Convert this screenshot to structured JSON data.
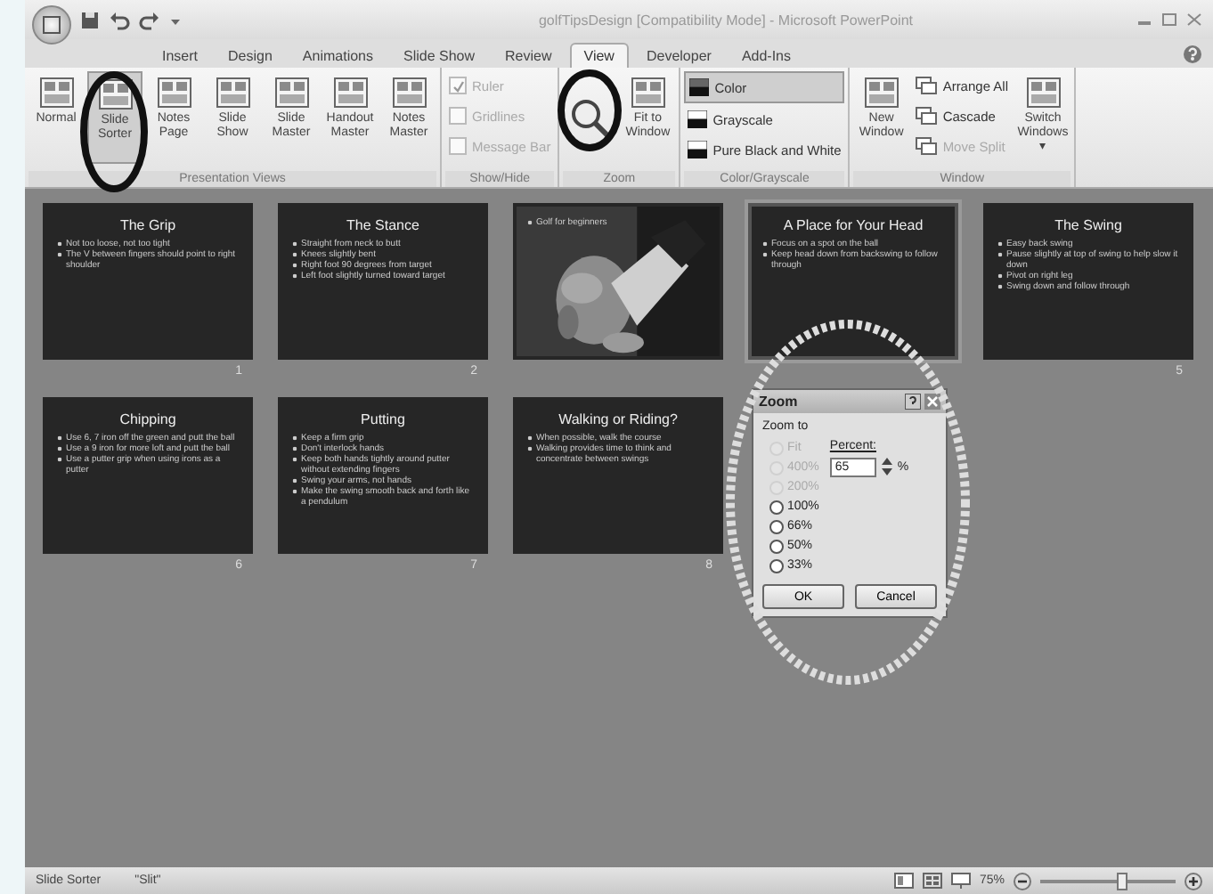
{
  "window": {
    "title": "golfTipsDesign [Compatibility Mode] - Microsoft PowerPoint"
  },
  "tabs": [
    {
      "label": "Insert",
      "selected": false
    },
    {
      "label": "Design",
      "selected": false
    },
    {
      "label": "Animations",
      "selected": false
    },
    {
      "label": "Slide Show",
      "selected": false
    },
    {
      "label": "Review",
      "selected": false
    },
    {
      "label": "View",
      "selected": true
    },
    {
      "label": "Developer",
      "selected": false
    },
    {
      "label": "Add-Ins",
      "selected": false
    }
  ],
  "ribbon": {
    "groups": [
      {
        "label": "Presentation Views",
        "items": [
          {
            "kind": "large",
            "label": "Normal"
          },
          {
            "kind": "large",
            "label": "Slide Sorter",
            "selected": true
          },
          {
            "kind": "large",
            "label": "Notes Page"
          },
          {
            "kind": "large",
            "label": "Slide Show"
          },
          {
            "kind": "large",
            "label": "Slide Master"
          },
          {
            "kind": "large",
            "label": "Handout Master"
          },
          {
            "kind": "large",
            "label": "Notes Master"
          }
        ]
      },
      {
        "label": "Show/Hide",
        "items": [
          {
            "kind": "check",
            "label": "Ruler",
            "checked": true,
            "disabled": true
          },
          {
            "kind": "check",
            "label": "Gridlines",
            "checked": false,
            "disabled": true
          },
          {
            "kind": "check",
            "label": "Message Bar",
            "checked": false,
            "disabled": true
          }
        ]
      },
      {
        "label": "Zoom",
        "items": [
          {
            "kind": "zoom"
          },
          {
            "kind": "large",
            "label": "Fit to Window"
          }
        ]
      },
      {
        "label": "Color/Grayscale",
        "items": [
          {
            "kind": "swatch",
            "label": "Color",
            "selected": true
          },
          {
            "kind": "swatch",
            "label": "Grayscale",
            "selected": false
          },
          {
            "kind": "swatch",
            "label": "Pure Black and White",
            "selected": false
          }
        ]
      },
      {
        "label": "Window",
        "items": [
          {
            "kind": "large",
            "label": "New Window"
          },
          {
            "kind": "small",
            "label": "Arrange All",
            "disabled": false
          },
          {
            "kind": "small",
            "label": "Cascade",
            "disabled": false
          },
          {
            "kind": "small",
            "label": "Move Split",
            "disabled": true
          },
          {
            "kind": "large",
            "label": "Switch Windows ▾"
          }
        ]
      }
    ]
  },
  "slides": [
    {
      "kind": "text",
      "title": "The Grip",
      "bullets": [
        "Not too loose, not too tight",
        "The V between fingers should point to right shoulder"
      ],
      "number": "1",
      "selected": false
    },
    {
      "kind": "text",
      "title": "The Stance",
      "bullets": [
        "Straight from neck to butt",
        "Knees slightly bent",
        "Right foot 90 degrees from target",
        "Left foot slightly turned toward target"
      ],
      "number": "2",
      "selected": false
    },
    {
      "kind": "picture",
      "bullets": [
        "Golf for beginners"
      ],
      "selected": false
    },
    {
      "kind": "text",
      "title": "A Place for Your Head",
      "bullets": [
        "Focus on a spot on the ball",
        "Keep head down from backswing to follow through"
      ],
      "selected": true
    },
    {
      "kind": "text",
      "title": "The Swing",
      "bullets": [
        "Easy back swing",
        "Pause slightly at top of swing to help slow it down",
        "Pivot on right leg",
        "Swing down and follow through"
      ],
      "number": "5",
      "selected": false
    },
    {
      "kind": "text",
      "title": "Chipping",
      "bullets": [
        "Use 6, 7 iron off the green and putt the ball",
        "Use a 9 iron for more loft and putt the ball",
        "Use a putter grip when using irons as a putter"
      ],
      "number": "6",
      "selected": false
    },
    {
      "kind": "text",
      "title": "Putting",
      "bullets": [
        "Keep a firm grip",
        "Don't interlock hands",
        "Keep both hands tightly around putter without extending fingers",
        "Swing your arms, not hands",
        "Make the swing smooth back and forth like a pendulum"
      ],
      "number": "7",
      "selected": false
    },
    {
      "kind": "text",
      "title": "Walking or Riding?",
      "bullets": [
        "When possible, walk the course",
        "Walking provides time to think and concentrate between swings"
      ],
      "number": "8",
      "selected": false
    }
  ],
  "zoom_dialog": {
    "title": "Zoom",
    "group_label": "Zoom to",
    "options": [
      {
        "label": "Fit",
        "disabled": true,
        "selected": false
      },
      {
        "label": "400%",
        "disabled": true,
        "selected": false
      },
      {
        "label": "200%",
        "disabled": true,
        "selected": false
      },
      {
        "label": "100%",
        "disabled": false,
        "selected": false
      },
      {
        "label": "66%",
        "disabled": false,
        "selected": false
      },
      {
        "label": "50%",
        "disabled": false,
        "selected": false
      },
      {
        "label": "33%",
        "disabled": false,
        "selected": false
      }
    ],
    "percent_label": "Percent:",
    "percent_value": "65",
    "percent_sign": "%",
    "buttons": [
      "OK",
      "Cancel"
    ]
  },
  "status_bar": {
    "view": "Slide Sorter",
    "theme": "\"Slit\"",
    "zoom": "75%",
    "zoom_slider": {
      "level": 0.6
    }
  }
}
